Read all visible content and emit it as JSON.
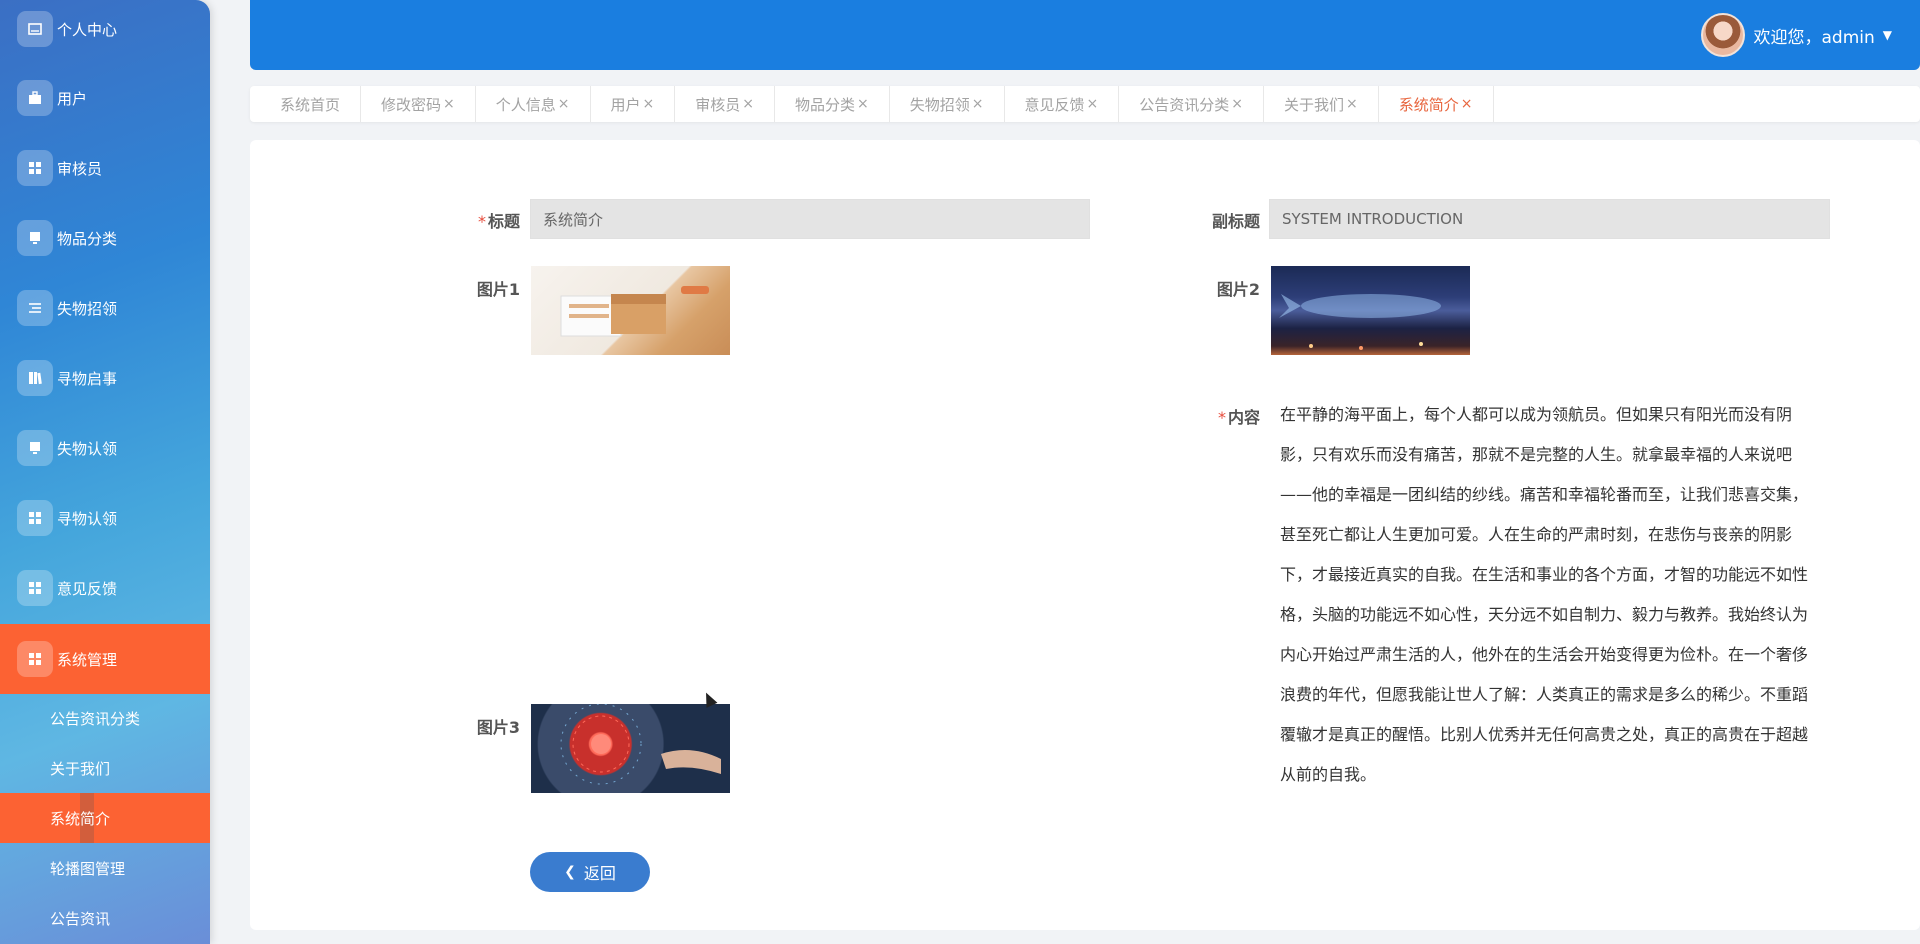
{
  "sidebar": {
    "items": [
      {
        "label": "个人中心",
        "icon": "card-icon"
      },
      {
        "label": "用户",
        "icon": "briefcase-icon"
      },
      {
        "label": "审核员",
        "icon": "grid-icon"
      },
      {
        "label": "物品分类",
        "icon": "monitor-icon"
      },
      {
        "label": "失物招领",
        "icon": "list-icon"
      },
      {
        "label": "寻物启事",
        "icon": "book-icon"
      },
      {
        "label": "失物认领",
        "icon": "monitor-icon"
      },
      {
        "label": "寻物认领",
        "icon": "grid-icon"
      },
      {
        "label": "意见反馈",
        "icon": "grid-icon"
      },
      {
        "label": "系统管理",
        "icon": "grid-icon"
      }
    ],
    "sub_items": [
      {
        "label": "公告资讯分类"
      },
      {
        "label": "关于我们"
      },
      {
        "label": "系统简介"
      },
      {
        "label": "轮播图管理"
      },
      {
        "label": "公告资讯"
      }
    ]
  },
  "header": {
    "welcome": "欢迎您，admin"
  },
  "tabs": [
    {
      "label": "系统首页",
      "closable": false
    },
    {
      "label": "修改密码",
      "closable": true
    },
    {
      "label": "个人信息",
      "closable": true
    },
    {
      "label": "用户",
      "closable": true
    },
    {
      "label": "审核员",
      "closable": true
    },
    {
      "label": "物品分类",
      "closable": true
    },
    {
      "label": "失物招领",
      "closable": true
    },
    {
      "label": "意见反馈",
      "closable": true
    },
    {
      "label": "公告资讯分类",
      "closable": true
    },
    {
      "label": "关于我们",
      "closable": true
    },
    {
      "label": "系统简介",
      "closable": true
    }
  ],
  "tab_close_glyph": "×",
  "form": {
    "title_label": "标题",
    "title_value": "系统简介",
    "subtitle_label": "副标题",
    "subtitle_value": "SYSTEM INTRODUCTION",
    "pic1_label": "图片1",
    "pic2_label": "图片2",
    "pic3_label": "图片3",
    "content_label": "内容",
    "content_value": "在平静的海平面上，每个人都可以成为领航员。但如果只有阳光而没有阴影，只有欢乐而没有痛苦，那就不是完整的人生。就拿最幸福的人来说吧——他的幸福是一团纠结的纱线。痛苦和幸福轮番而至，让我们悲喜交集，甚至死亡都让人生更加可爱。人在生命的严肃时刻，在悲伤与丧亲的阴影下，才最接近真实的自我。在生活和事业的各个方面，才智的功能远不如性格，头脑的功能远不如心性，天分远不如自制力、毅力与教养。我始终认为内心开始过严肃生活的人，他外在的生活会开始变得更为俭朴。在一个奢侈浪费的年代，但愿我能让世人了解：人类真正的需求是多么的稀少。不重蹈覆辙才是真正的醒悟。比别人优秀并无任何高贵之处，真正的高贵在于超越从前的自我。",
    "required_mark": "*",
    "back_label": "返回"
  },
  "colors": {
    "header": "#1a7ee0",
    "active": "#fc6233",
    "button": "#3a7ccf",
    "active_tab_text": "#e8663f"
  }
}
